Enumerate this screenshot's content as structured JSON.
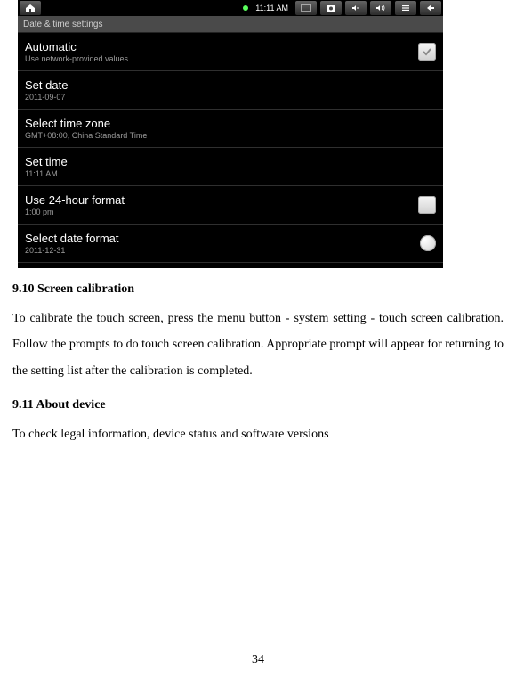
{
  "statusbar": {
    "time": "11:11 AM"
  },
  "titlebar": "Date & time settings",
  "rows": [
    {
      "title": "Automatic",
      "sub": "Use network-provided values",
      "ctrl": "checkbox"
    },
    {
      "title": "Set date",
      "sub": "2011-09-07",
      "ctrl": "none"
    },
    {
      "title": "Select time zone",
      "sub": "GMT+08:00, China Standard Time",
      "ctrl": "none"
    },
    {
      "title": "Set time",
      "sub": "11:11 AM",
      "ctrl": "none"
    },
    {
      "title": "Use 24-hour format",
      "sub": "1:00 pm",
      "ctrl": "checkbox"
    },
    {
      "title": "Select date format",
      "sub": "2011-12-31",
      "ctrl": "radio"
    }
  ],
  "section910": {
    "heading": "9.10 Screen calibration",
    "body": "To calibrate the touch screen, press the menu button - system setting - touch screen calibration. Follow the prompts to do touch screen calibration. Appropriate prompt will appear for returning to the setting list after the calibration is completed."
  },
  "section911": {
    "heading": "9.11 About device",
    "body": "To check legal information, device status and software versions"
  },
  "page_number": "34"
}
